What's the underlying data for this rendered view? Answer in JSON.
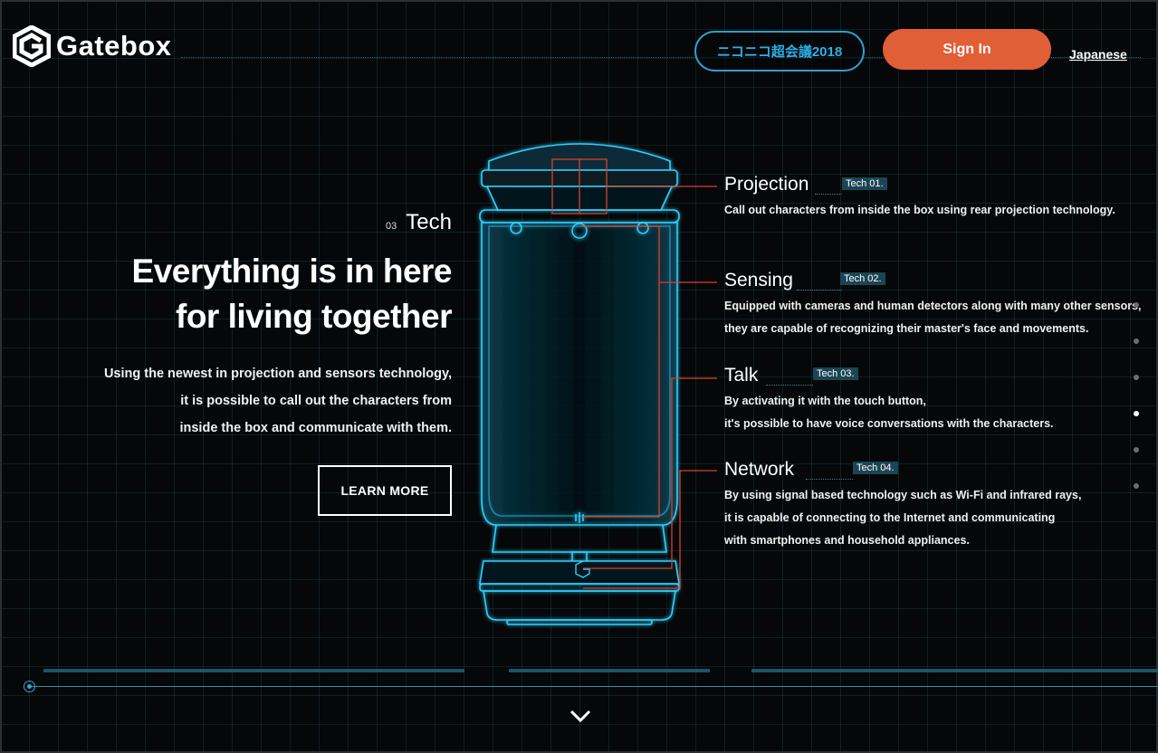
{
  "header": {
    "logo_text": "Gatebox",
    "event_button": "ニコニコ超会議2018",
    "signin_button": "Sign In",
    "language_link": "Japanese"
  },
  "section": {
    "number": "03",
    "name": "Tech",
    "headline_line1": "Everything is in here",
    "headline_line2": "for living together",
    "lead_line1": "Using the newest in projection and sensors technology,",
    "lead_line2": "it is possible to call out the characters from",
    "lead_line3": "inside the box and communicate with them.",
    "learn_more": "LEARN MORE"
  },
  "features": [
    {
      "title": "Projection",
      "tag": "Tech 01.",
      "desc": [
        "Call out characters from inside the box using rear projection technology."
      ]
    },
    {
      "title": "Sensing",
      "tag": "Tech 02.",
      "desc": [
        "Equipped with cameras and human detectors along with many other sensors,",
        "they are capable of recognizing their master's face and movements."
      ]
    },
    {
      "title": "Talk",
      "tag": "Tech 03.",
      "desc": [
        "By activating it with the touch button,",
        "it's possible to have voice conversations with the characters."
      ]
    },
    {
      "title": "Network",
      "tag": "Tech 04.",
      "desc": [
        "By using signal based technology such as Wi-Fi and infrared rays,",
        "it is capable of connecting to the Internet and communicating",
        "with smartphones and household appliances."
      ]
    }
  ],
  "pager": {
    "count": 6,
    "active_index": 3
  },
  "colors": {
    "accent": "#2ab0e6",
    "signin": "#e05f36",
    "leader_lines": "#d9412b",
    "device_glow": "#2fd0ff"
  },
  "icons": {
    "logo": "gatebox-logo-icon",
    "scroll": "chevron-down-icon"
  }
}
